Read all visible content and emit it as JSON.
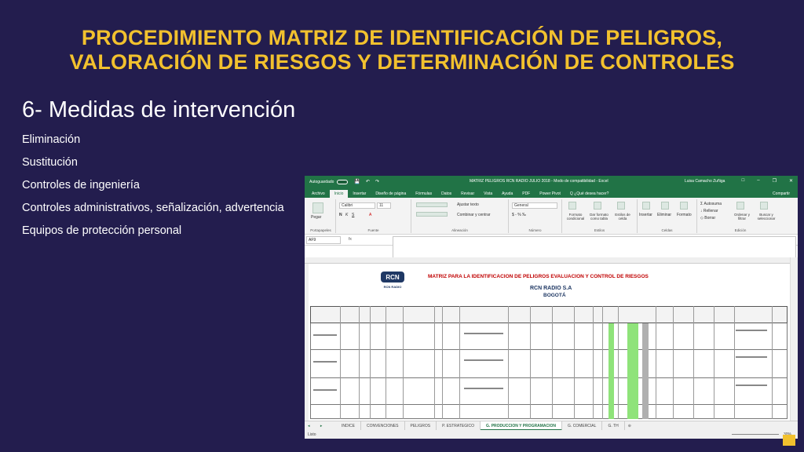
{
  "slide": {
    "title_line1": "PROCEDIMIENTO MATRIZ DE IDENTIFICACIÓN DE PELIGROS,",
    "title_line2": "VALORACIÓN DE RIESGOS Y DETERMINACIÓN DE CONTROLES",
    "subtitle": "6- Medidas de intervención",
    "bullets": [
      "Eliminación",
      "Sustitución",
      "Controles de ingeniería",
      "Controles administrativos, señalización, advertencia",
      "Equipos de protección personal"
    ],
    "colors": {
      "background": "#231d4e",
      "title": "#f2c12e",
      "excel_green": "#217346"
    }
  },
  "excel": {
    "autosave_label": "Autoguardado",
    "window_title": "MATRIZ PELIGROS RCN RADIO JULIO 2018  -  Modo de compatibilidad  -  Excel",
    "user": "Luisa Camacho Zuñiga",
    "ribbon_tabs": [
      "Archivo",
      "Inicio",
      "Insertar",
      "Diseño de página",
      "Fórmulas",
      "Datos",
      "Revisar",
      "Vista",
      "Ayuda",
      "PDF",
      "Power Pivot",
      "Q ¿Qué desea hacer?"
    ],
    "share_label": "Compartir",
    "ribbon": {
      "paste": "Pegar",
      "clipboard": "Portapapeles",
      "font_name": "Calibri",
      "font_size": "11",
      "font_group": "Fuente",
      "wrap_text": "Ajustar texto",
      "merge_center": "Combinar y centrar",
      "alignment_group": "Alineación",
      "number_format": "General",
      "number_group": "Número",
      "cond_format": "Formato condicional",
      "format_table": "Dar formato como tabla",
      "cell_styles": "Estilos de celda",
      "styles_group": "Estilos",
      "insert": "Insertar",
      "delete": "Eliminar",
      "format": "Formato",
      "cells_group": "Celdas",
      "autosum": "Autosuma",
      "fill": "Rellenar",
      "clear": "Borrar",
      "sort_filter": "Ordenar y filtrar",
      "find_select": "Buscar y seleccionar",
      "editing_group": "Edición"
    },
    "name_box": "AF9",
    "fx": "fx",
    "sheet": {
      "banner": "MATRIZ PARA LA IDENTIFICACION DE PELIGROS EVALUACION Y CONTROL DE RIESGOS",
      "company": "RCN RADIO S.A",
      "city": "BOGOTÁ",
      "logo_text": "RCN RADIO"
    },
    "sheet_tabs": [
      "INDICE",
      "CONVENCIONES",
      "PELIGROS",
      "P. ESTRATEGICO",
      "G. PRODUCCION Y PROGRAMACION",
      "G. COMERCIAL",
      "G. TH"
    ],
    "active_sheet": "G. PRODUCCION Y PROGRAMACION",
    "status_ready": "Listo",
    "zoom": "30%"
  }
}
